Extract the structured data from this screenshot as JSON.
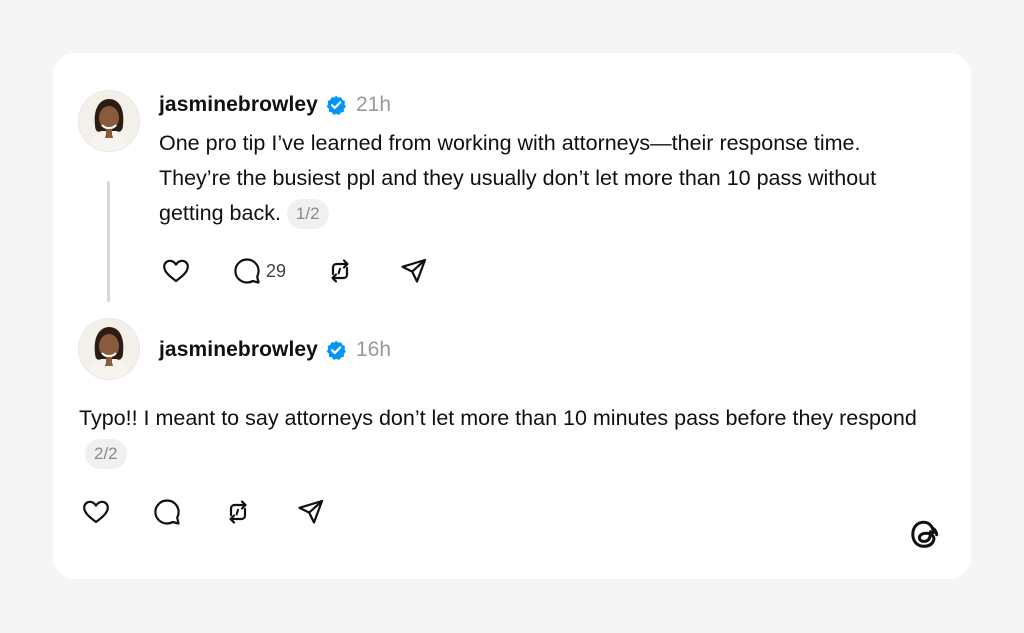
{
  "posts": [
    {
      "username": "jasminebrowley",
      "time": "21h",
      "text": "One pro tip I’ve learned from working with attorneys—their response time. They’re the busiest ppl and they usually don’t let more than 10 pass without getting back.",
      "page_indicator": "1/2",
      "reply_count": "29"
    },
    {
      "username": "jasminebrowley",
      "time": "16h",
      "text": "Typo!! I meant to say attorneys don’t let more than 10 minutes pass before they respond",
      "page_indicator": "2/2"
    }
  ],
  "colors": {
    "verified_badge": "#0095f6",
    "background": "#f5f5f5",
    "card": "#ffffff",
    "secondary_text": "#999999"
  },
  "icons": [
    "verified-icon",
    "like-icon",
    "comment-icon",
    "repost-icon",
    "share-icon",
    "threads-logo-icon"
  ]
}
